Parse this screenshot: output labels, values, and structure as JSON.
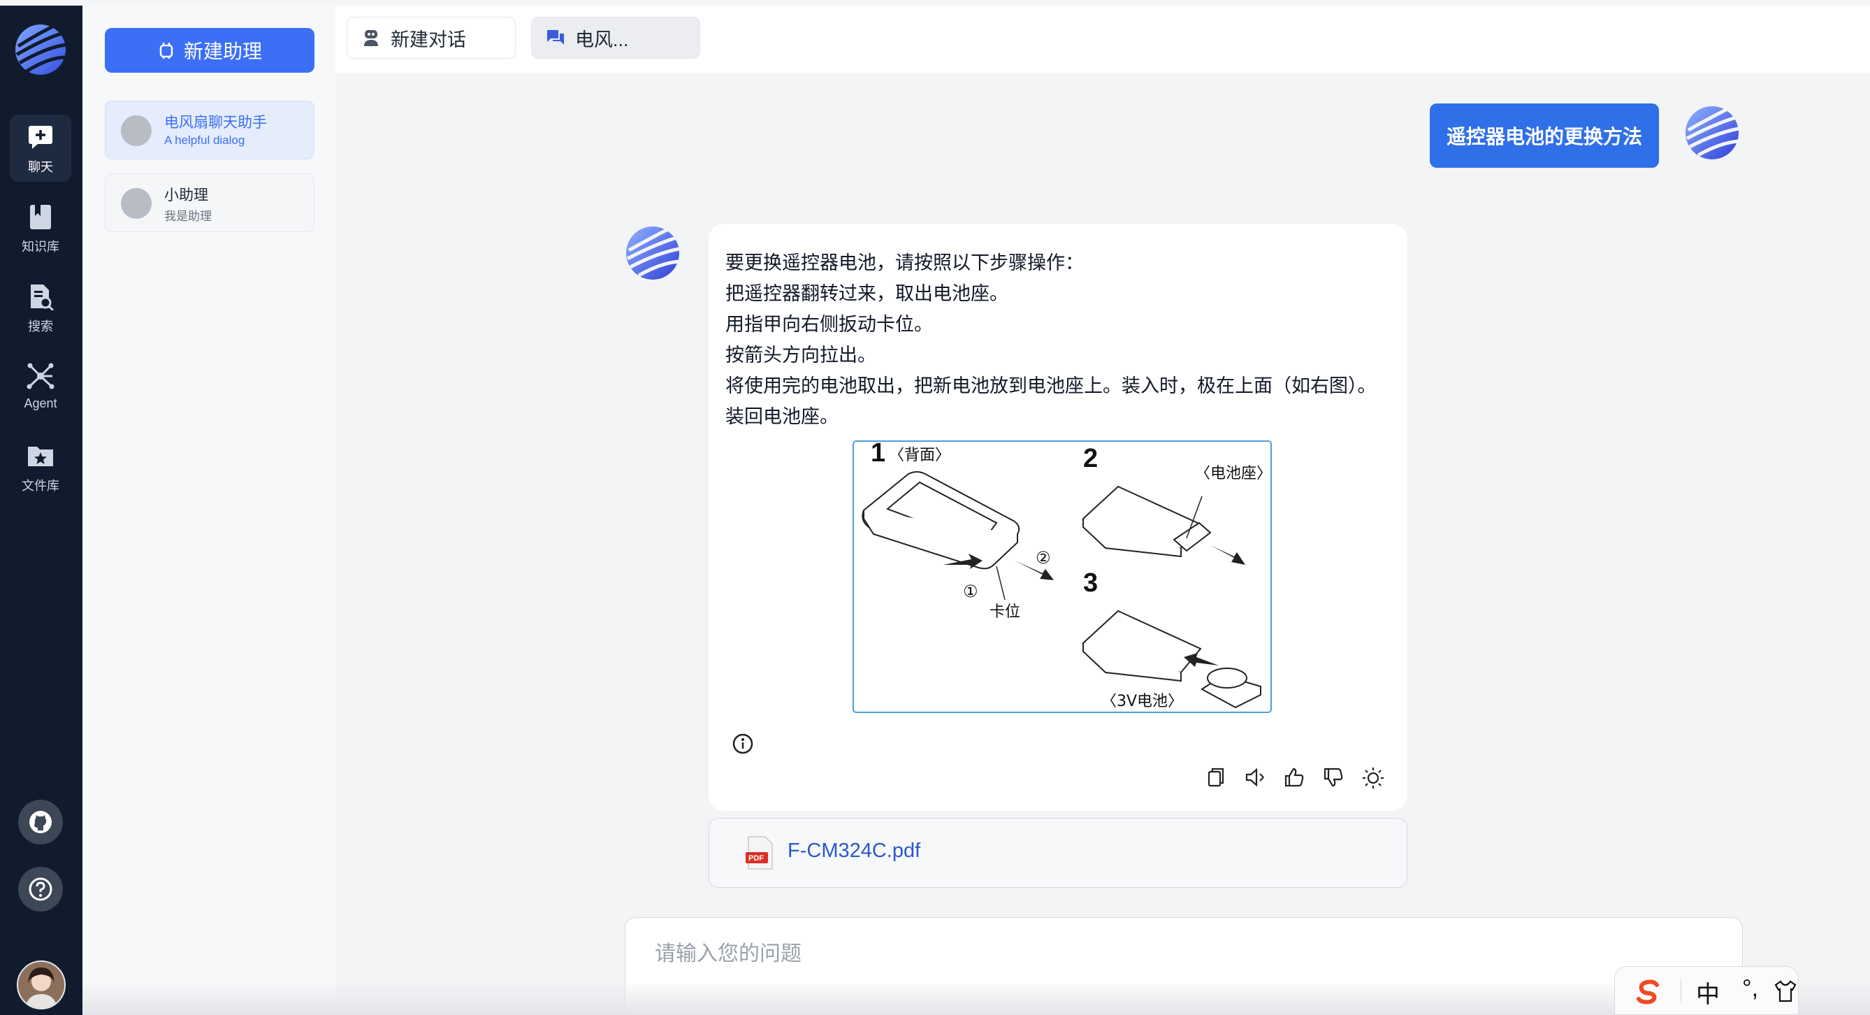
{
  "sidebar": {
    "items": [
      {
        "label": "聊天",
        "icon": "chat-add-icon"
      },
      {
        "label": "知识库",
        "icon": "book-icon"
      },
      {
        "label": "搜索",
        "icon": "search-doc-icon"
      },
      {
        "label": "Agent",
        "icon": "agent-icon"
      },
      {
        "label": "文件库",
        "icon": "folder-star-icon"
      }
    ],
    "bottom_icons": [
      "github-icon",
      "help-icon",
      "avatar"
    ]
  },
  "assistants": {
    "new_button": "新建助理",
    "list": [
      {
        "name": "电风扇聊天助手",
        "desc": "A helpful dialog"
      },
      {
        "name": "小助理",
        "desc": "我是助理"
      }
    ]
  },
  "tabs": [
    {
      "label": "新建对话",
      "icon": "robot-icon"
    },
    {
      "label": "电风...",
      "icon": "chat-bubble-icon"
    }
  ],
  "chat": {
    "user_message": "遥控器电池的更换方法",
    "answer_lines": [
      "要更换遥控器电池，请按照以下步骤操作：",
      "把遥控器翻转过来，取出电池座。",
      "用指甲向右侧扳动卡位。",
      "按箭头方向拉出。",
      "将使用完的电池取出，把新电池放到电池座上。装入时，极在上面（如右图）。",
      "装回电池座。"
    ],
    "figure": {
      "step1": "1",
      "step1_note": "〈背面〉",
      "step2": "2",
      "step2_note": "〈电池座〉",
      "step3": "3",
      "step3_note": "〈3V电池〉",
      "circle1": "①",
      "circle2": "②",
      "latch": "卡位"
    },
    "action_icons": [
      "copy-icon",
      "speaker-icon",
      "thumbs-up-icon",
      "thumbs-down-icon",
      "lightbulb-icon"
    ],
    "reference_file": "F-CM324C.pdf",
    "pdf_badge": "PDF"
  },
  "input": {
    "placeholder": "请输入您的问题"
  },
  "ime_bar": {
    "mode": "中",
    "punct": "°,"
  },
  "colors": {
    "rail": "#101b2d",
    "accent": "#3b6ff5",
    "user_bubble": "#2f6fe8",
    "figure_border": "#4a9fe0"
  }
}
